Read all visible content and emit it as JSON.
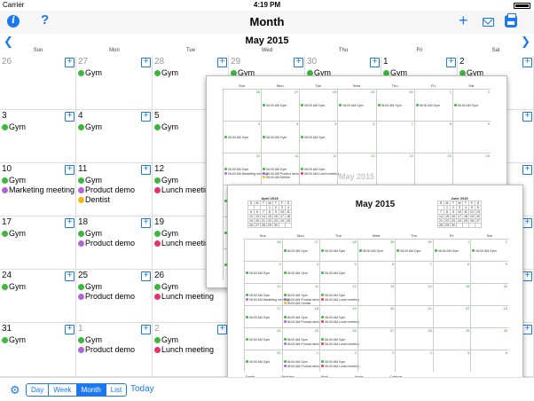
{
  "status": {
    "carrier": "Carrier",
    "time": "4:19 PM"
  },
  "navbar": {
    "title": "Month"
  },
  "month_header": {
    "title": "May 2015"
  },
  "weekdays": [
    "Sun",
    "Mon",
    "Tue",
    "Wed",
    "Thu",
    "Fri",
    "Sat"
  ],
  "colors": {
    "accent": "#1b78f1",
    "gym": "#3cb83c",
    "marketing": "#b166d6",
    "product": "#b166d6",
    "lunch": "#e8336a",
    "dentist": "#f2b90f"
  },
  "weeks": [
    [
      {
        "d": "26",
        "grey": true,
        "ev": []
      },
      {
        "d": "27",
        "grey": true,
        "ev": [
          {
            "t": "Gym",
            "c": "gym"
          }
        ]
      },
      {
        "d": "28",
        "grey": true,
        "ev": [
          {
            "t": "Gym",
            "c": "gym"
          }
        ]
      },
      {
        "d": "29",
        "grey": true,
        "ev": [
          {
            "t": "Gym",
            "c": "gym"
          }
        ]
      },
      {
        "d": "30",
        "grey": true,
        "ev": [
          {
            "t": "Gym",
            "c": "gym"
          }
        ]
      },
      {
        "d": "1",
        "ev": [
          {
            "t": "Gym",
            "c": "gym"
          }
        ]
      },
      {
        "d": "2",
        "ev": [
          {
            "t": "Gym",
            "c": "gym"
          }
        ]
      }
    ],
    [
      {
        "d": "3",
        "ev": [
          {
            "t": "Gym",
            "c": "gym"
          }
        ]
      },
      {
        "d": "4",
        "ev": [
          {
            "t": "Gym",
            "c": "gym"
          }
        ]
      },
      {
        "d": "5",
        "ev": [
          {
            "t": "Gym",
            "c": "gym"
          }
        ]
      },
      {
        "d": "6",
        "ev": []
      },
      {
        "d": "7",
        "ev": []
      },
      {
        "d": "8",
        "ev": []
      },
      {
        "d": "9",
        "ev": []
      }
    ],
    [
      {
        "d": "10",
        "ev": [
          {
            "t": "Gym",
            "c": "gym"
          },
          {
            "t": "Marketing meeting",
            "c": "marketing"
          }
        ]
      },
      {
        "d": "11",
        "ev": [
          {
            "t": "Gym",
            "c": "gym"
          },
          {
            "t": "Product demo",
            "c": "product"
          },
          {
            "t": "Dentist",
            "c": "dentist"
          }
        ]
      },
      {
        "d": "12",
        "ev": [
          {
            "t": "Gym",
            "c": "gym"
          },
          {
            "t": "Lunch meeting",
            "c": "lunch"
          }
        ]
      },
      {
        "d": "13",
        "ev": []
      },
      {
        "d": "14",
        "ev": []
      },
      {
        "d": "15",
        "ev": []
      },
      {
        "d": "16",
        "ev": []
      }
    ],
    [
      {
        "d": "17",
        "ev": [
          {
            "t": "Gym",
            "c": "gym"
          }
        ]
      },
      {
        "d": "18",
        "ev": [
          {
            "t": "Gym",
            "c": "gym"
          },
          {
            "t": "Product demo",
            "c": "product"
          }
        ]
      },
      {
        "d": "19",
        "ev": [
          {
            "t": "Gym",
            "c": "gym"
          },
          {
            "t": "Lunch meeting",
            "c": "lunch"
          }
        ]
      },
      {
        "d": "20",
        "ev": []
      },
      {
        "d": "21",
        "ev": []
      },
      {
        "d": "22",
        "ev": []
      },
      {
        "d": "23",
        "ev": []
      }
    ],
    [
      {
        "d": "24",
        "ev": [
          {
            "t": "Gym",
            "c": "gym"
          }
        ]
      },
      {
        "d": "25",
        "ev": [
          {
            "t": "Gym",
            "c": "gym"
          },
          {
            "t": "Product demo",
            "c": "product"
          }
        ]
      },
      {
        "d": "26",
        "ev": [
          {
            "t": "Gym",
            "c": "gym"
          },
          {
            "t": "Lunch meeting",
            "c": "lunch"
          }
        ]
      },
      {
        "d": "27",
        "ev": []
      },
      {
        "d": "28",
        "ev": []
      },
      {
        "d": "29",
        "ev": []
      },
      {
        "d": "30",
        "ev": []
      }
    ],
    [
      {
        "d": "31",
        "ev": [
          {
            "t": "Gym",
            "c": "gym"
          }
        ]
      },
      {
        "d": "1",
        "grey": true,
        "ev": [
          {
            "t": "Gym",
            "c": "gym"
          },
          {
            "t": "Product demo",
            "c": "product"
          }
        ]
      },
      {
        "d": "2",
        "grey": true,
        "ev": [
          {
            "t": "Gym",
            "c": "gym"
          },
          {
            "t": "Lunch meeting",
            "c": "lunch"
          }
        ]
      },
      {
        "d": "3",
        "grey": true,
        "ev": []
      },
      {
        "d": "4",
        "grey": true,
        "ev": []
      },
      {
        "d": "5",
        "grey": true,
        "ev": []
      },
      {
        "d": "6",
        "grey": true,
        "ev": []
      }
    ]
  ],
  "add_label": "+",
  "toolbar": {
    "views": [
      "Day",
      "Week",
      "Month",
      "List"
    ],
    "active_view": "Month",
    "today": "Today"
  },
  "print_preview": {
    "back_title": "May 2015",
    "front_title": "May 2015",
    "mini_left": {
      "title": "April 2015",
      "head": [
        "S",
        "M",
        "T",
        "W",
        "T",
        "F",
        "S"
      ],
      "rows": [
        [
          "",
          "",
          "",
          "1",
          "2",
          "3",
          "4"
        ],
        [
          "5",
          "6",
          "7",
          "8",
          "9",
          "10",
          "11"
        ],
        [
          "12",
          "13",
          "14",
          "15",
          "16",
          "17",
          "18"
        ],
        [
          "19",
          "20",
          "21",
          "22",
          "23",
          "24",
          "25"
        ],
        [
          "26",
          "27",
          "28",
          "29",
          "30",
          "",
          ""
        ]
      ]
    },
    "mini_right": {
      "title": "June 2015",
      "head": [
        "S",
        "M",
        "T",
        "W",
        "T",
        "F",
        "S"
      ],
      "rows": [
        [
          "",
          "1",
          "2",
          "3",
          "4",
          "5",
          "6"
        ],
        [
          "7",
          "8",
          "9",
          "10",
          "11",
          "12",
          "13"
        ],
        [
          "14",
          "15",
          "16",
          "17",
          "18",
          "19",
          "20"
        ],
        [
          "21",
          "22",
          "23",
          "24",
          "25",
          "26",
          "27"
        ],
        [
          "28",
          "29",
          "30",
          "",
          "",
          "",
          ""
        ]
      ]
    },
    "event_prefix": "06:00 AM",
    "legend": [
      "Family",
      "Birthdays",
      "Work",
      "Home",
      "Calendar"
    ]
  }
}
